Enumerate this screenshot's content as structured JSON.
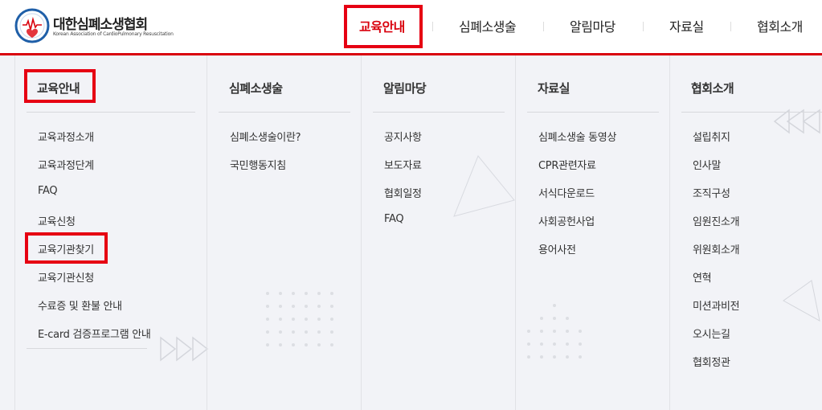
{
  "header": {
    "logo_title": "대한심폐소생협회",
    "logo_subtitle": "Korean Association of CardioPulmonary Resuscitation"
  },
  "colors": {
    "accent": "#d9000d",
    "highlight": "#e60012",
    "panel_bg": "#f2f3f7"
  },
  "gnb": [
    {
      "label": "교육안내",
      "active": true
    },
    {
      "label": "심폐소생술",
      "active": false
    },
    {
      "label": "알림마당",
      "active": false
    },
    {
      "label": "자료실",
      "active": false
    },
    {
      "label": "협회소개",
      "active": false
    }
  ],
  "menu": [
    {
      "title": "교육안내",
      "items": [
        "교육과정소개",
        "교육과정단계",
        "FAQ",
        "교육신청",
        "교육기관찾기",
        "교육기관신청",
        "수료증 및 환불 안내",
        "E-card 검증프로그램 안내"
      ]
    },
    {
      "title": "심폐소생술",
      "items": [
        "심폐소생술이란?",
        "국민행동지침"
      ]
    },
    {
      "title": "알림마당",
      "items": [
        "공지사항",
        "보도자료",
        "협회일정",
        "FAQ"
      ]
    },
    {
      "title": "자료실",
      "items": [
        "심폐소생술 동영상",
        "CPR관련자료",
        "서식다운로드",
        "사회공헌사업",
        "용어사전"
      ]
    },
    {
      "title": "협회소개",
      "items": [
        "설립취지",
        "인사말",
        "조직구성",
        "임원진소개",
        "위원회소개",
        "연혁",
        "미션과비전",
        "오시는길",
        "협회정관"
      ]
    }
  ]
}
